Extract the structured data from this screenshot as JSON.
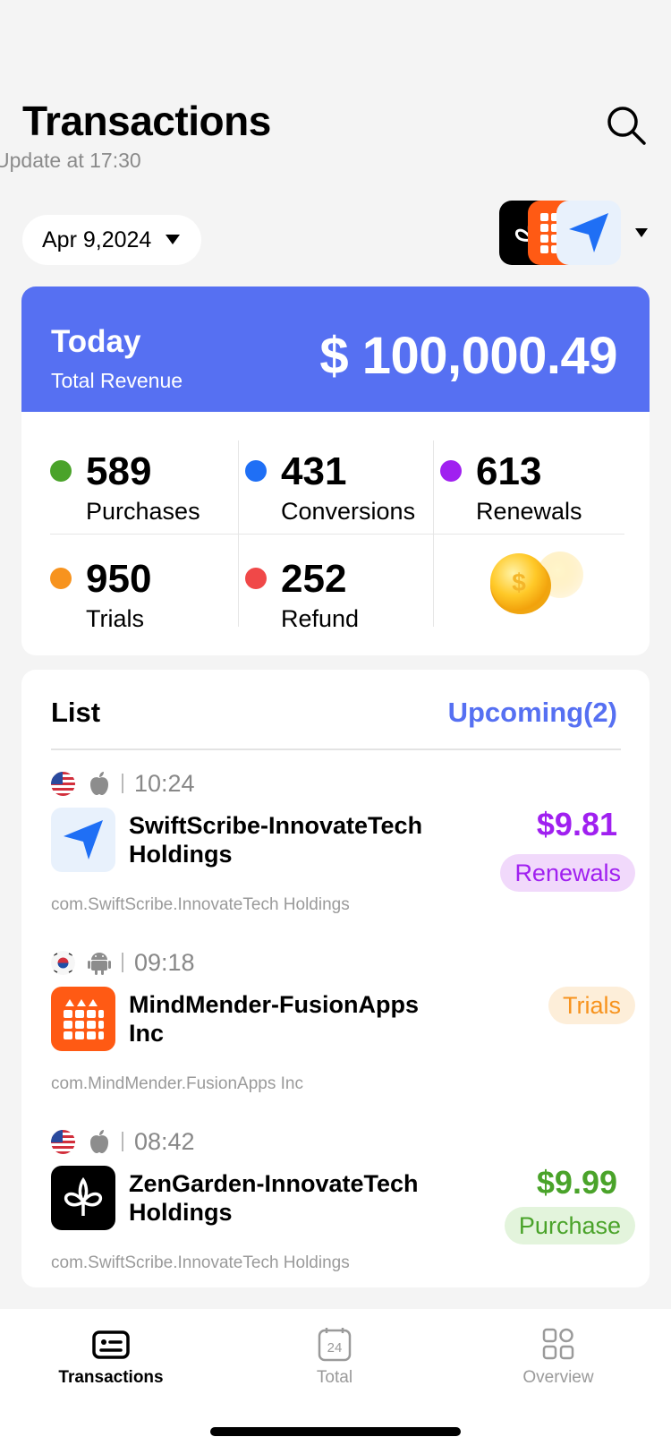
{
  "header": {
    "title": "Transactions",
    "subtitle": "Update at 17:30",
    "search_icon": "search-icon"
  },
  "filter": {
    "date": "Apr 9,2024",
    "apps": [
      "ZenGarden",
      "MindMender",
      "SwiftScribe"
    ]
  },
  "summary": {
    "period": "Today",
    "label": "Total Revenue",
    "amount": "$ 100,000.49",
    "accent_color": "#5670f2"
  },
  "stats": [
    {
      "value": "589",
      "label": "Purchases",
      "color": "#4aa32a"
    },
    {
      "value": "431",
      "label": "Conversions",
      "color": "#1f6ff5"
    },
    {
      "value": "613",
      "label": "Renewals",
      "color": "#a020f0"
    },
    {
      "value": "950",
      "label": "Trials",
      "color": "#f7931e"
    },
    {
      "value": "252",
      "label": "Refund",
      "color": "#f04848"
    }
  ],
  "list": {
    "title": "List",
    "upcoming": "Upcoming(2)",
    "items": [
      {
        "flag": "us-flag-icon",
        "platform": "apple-icon",
        "time": "10:24",
        "app": "SwiftScribe-InnovateTech Holdings",
        "bundle": "com.SwiftScribe.InnovateTech Holdings",
        "price": "$9.81",
        "type": "Renewals",
        "price_color": "#a020f0",
        "badge_bg": "#f1d9fb",
        "badge_color": "#a020f0"
      },
      {
        "flag": "kr-flag-icon",
        "platform": "android-icon",
        "time": "09:18",
        "app": "MindMender-FusionApps Inc",
        "bundle": "com.MindMender.FusionApps Inc",
        "price": "",
        "type": "Trials",
        "price_color": "#f7931e",
        "badge_bg": "#fdeed9",
        "badge_color": "#f7931e"
      },
      {
        "flag": "us-flag-icon",
        "platform": "apple-icon",
        "time": "08:42",
        "app": "ZenGarden-InnovateTech Holdings",
        "bundle": "com.SwiftScribe.InnovateTech Holdings",
        "price": "$9.99",
        "type": "Purchase",
        "price_color": "#4aa32a",
        "badge_bg": "#e3f4dc",
        "badge_color": "#4aa32a"
      }
    ]
  },
  "tabbar": {
    "tabs": [
      {
        "label": "Transactions",
        "icon": "id-card-icon",
        "active": true
      },
      {
        "label": "Total",
        "icon": "calendar-icon",
        "active": false
      },
      {
        "label": "Overview",
        "icon": "grid-icon",
        "active": false
      }
    ]
  }
}
